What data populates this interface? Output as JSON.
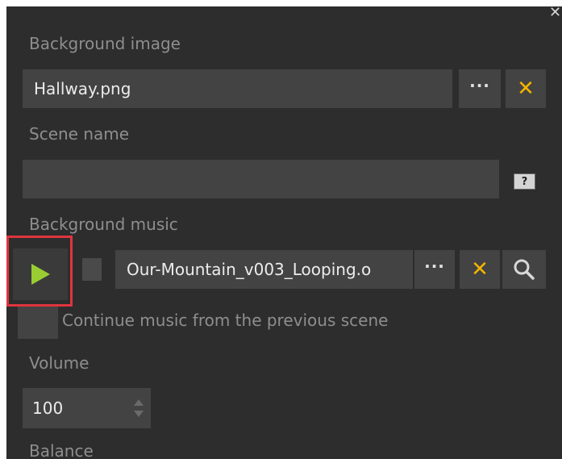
{
  "panel": {
    "background_image": {
      "label": "Background image",
      "value": "Hallway.png",
      "browse_label": "···"
    },
    "scene_name": {
      "label": "Scene name",
      "value": "",
      "help_label": "?"
    },
    "background_music": {
      "label": "Background music",
      "value": "Our-Mountain_v003_Looping.o",
      "browse_label": "···"
    },
    "continue_music": {
      "label": "Continue music from the previous scene",
      "checked": false
    },
    "volume": {
      "label": "Volume",
      "value": "100"
    },
    "balance": {
      "label": "Balance"
    }
  },
  "colors": {
    "panel_bg": "#2d2d2d",
    "field_bg": "#434343",
    "label_text": "#8e8e8e",
    "value_text": "#ececec",
    "clear_accent": "#f3b300",
    "play_accent": "#9acd32",
    "highlight": "#e0343e"
  },
  "icons": [
    "close-icon",
    "more-icon",
    "clear-icon",
    "help-icon",
    "play-icon",
    "stop-icon",
    "search-icon",
    "spinner-icon"
  ]
}
